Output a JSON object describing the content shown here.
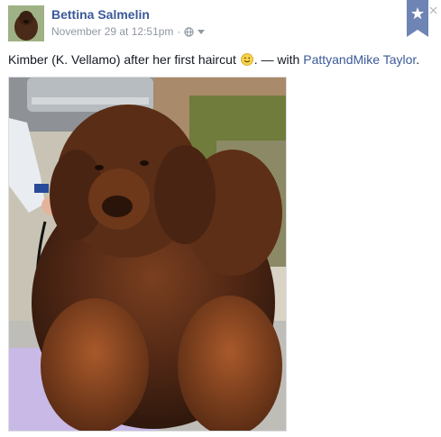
{
  "post": {
    "author": "Bettina Salmelin",
    "timestamp": "November 29 at 12:51pm",
    "separator": "·",
    "caption": {
      "text_before": "Kimber (K. Vellamo) after her first haircut",
      "text_middle": ". — with",
      "tagged": "PattyandMike Taylor",
      "text_after": "."
    },
    "photo_alt": "Brown Newfoundland dog sitting on a grooming table",
    "icons": {
      "star": "star-icon",
      "globe": "globe-icon",
      "caret": "chevron-down-icon",
      "smile": "smile-emoji-icon",
      "close": "close-icon"
    }
  },
  "colors": {
    "link": "#3b5998",
    "meta": "#9197a3",
    "bookmark": "#6d84b4",
    "text": "#141823"
  }
}
